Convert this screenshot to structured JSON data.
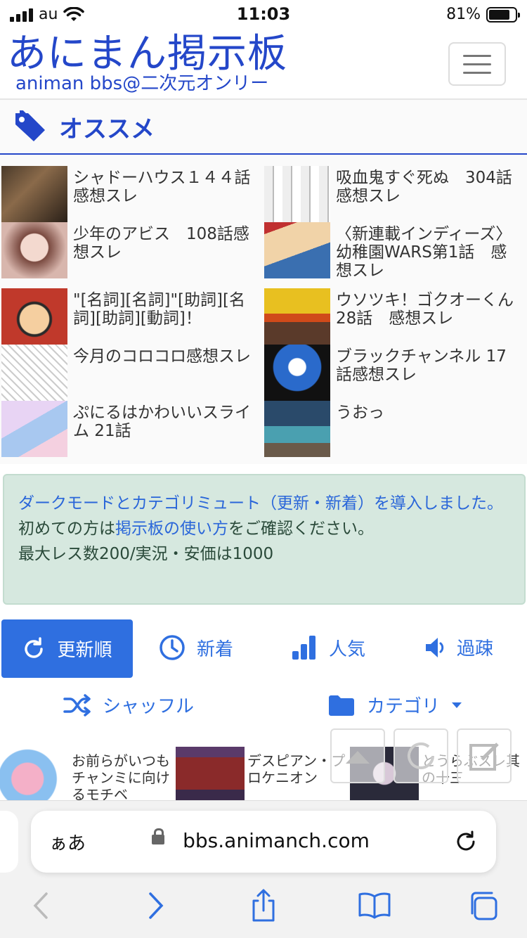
{
  "status_bar": {
    "carrier": "au",
    "time": "11:03",
    "battery": "81%",
    "battery_level": 0.81
  },
  "header": {
    "logo": "あにまん掲示板",
    "logo_sub": "animan bbs@二次元オンリー"
  },
  "recommended": {
    "title": "オススメ",
    "items": [
      {
        "title": "シャドーハウス１４４話感想スレ"
      },
      {
        "title": "吸血鬼すぐ死ぬ　304話感想スレ"
      },
      {
        "title": "少年のアビス　108話感想スレ"
      },
      {
        "title": "〈新連載インディーズ〉幼稚園WARS第1話　感想スレ"
      },
      {
        "title": "\"[名詞][名詞]\"[助詞][名詞][助詞][動詞]！"
      },
      {
        "title": "ウソツキ！ゴクオーくん28話　感想スレ"
      },
      {
        "title": "今月のコロコロ感想スレ"
      },
      {
        "title": "ブラックチャンネル 17話感想スレ"
      },
      {
        "title": "ぷにるはかわいいスライム 21話"
      },
      {
        "title": "うおっ"
      }
    ]
  },
  "notice": {
    "line1": "ダークモードとカテゴリミュート（更新・新着）を導入しました。",
    "line2_pre": "初めての方は",
    "line2_link": "掲示板の使い方",
    "line2_post": "をご確認ください。",
    "line3": "最大レス数200/実況・安価は1000"
  },
  "tabs": {
    "update": "更新順",
    "new": "新着",
    "popular": "人気",
    "sparse": "過疎",
    "shuffle": "シャッフル",
    "category": "カテゴリ"
  },
  "strip": [
    {
      "title": "お前らがいつもチャンミに向けるモチベ"
    },
    {
      "title": "デスピアン・プロケニオン"
    },
    {
      "title": "とうらぶスレ其の十三"
    }
  ],
  "browser": {
    "aa": "ぁあ",
    "url": "bbs.animanch.com"
  },
  "colors": {
    "brand": "#2447c9",
    "accent": "#2f6fe0",
    "notice_bg": "#d6e8df"
  }
}
